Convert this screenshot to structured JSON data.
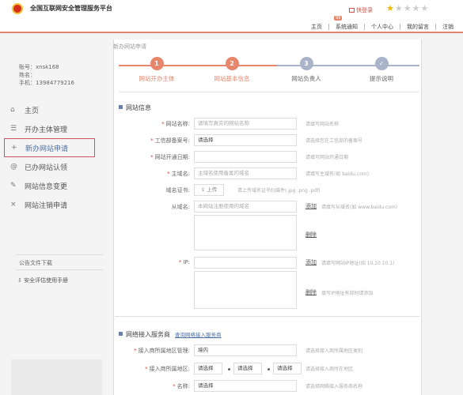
{
  "header": {
    "site_title": "全国互联网安全管理服务平台",
    "login_label": "快登录",
    "badge": "99",
    "nav": [
      "主页",
      "系统通知",
      "个人中心",
      "我的留言",
      "注销"
    ]
  },
  "colors": {
    "accent": "#e8866c",
    "active_border": "#d0505c",
    "link": "#4a6fa5",
    "step_pending": "#a9b3c9"
  },
  "rating": {
    "value": 1,
    "max": 5
  },
  "user": {
    "account": "账号：xnsk168",
    "name": "姓名：",
    "phone": "手机：13984779216"
  },
  "menu": [
    {
      "icon": "home-icon",
      "glyph": "⌂",
      "label": "主页"
    },
    {
      "icon": "list-icon",
      "glyph": "☰",
      "label": "开办主体管理"
    },
    {
      "icon": "plus-icon",
      "glyph": "+",
      "label": "新办网站申请"
    },
    {
      "icon": "at-icon",
      "glyph": "@",
      "label": "已办网站认领"
    },
    {
      "icon": "edit-icon",
      "glyph": "✎",
      "label": "网站信息变更"
    },
    {
      "icon": "cross-icon",
      "glyph": "×",
      "label": "网站注销申请"
    }
  ],
  "downloads": {
    "title": "公告文件下载",
    "manual": "安全评估使用手册"
  },
  "breadcrumb": "新办网站申请",
  "steps": [
    {
      "num": "1",
      "label": "网站开办主体",
      "state": "done"
    },
    {
      "num": "2",
      "label": "网站基本信息",
      "state": "current"
    },
    {
      "num": "3",
      "label": "网站负责人",
      "state": "pending"
    },
    {
      "num": "✓",
      "label": "提示说明",
      "state": "pending"
    }
  ],
  "website_info": {
    "title": "网站信息",
    "name_label": "网站名称:",
    "name_placeholder": "请填写真实的网站名称",
    "name_hint": "请填写网站名称",
    "icp_label": "工信部备案号:",
    "icp_value": "请选择",
    "icp_hint": "请选择您在工信部的备案号",
    "open_date_label": "网站开通日期:",
    "open_date_hint": "请填写网站开通日期",
    "domain_label": "主域名:",
    "domain_placeholder": "主域名使用备案的域名",
    "domain_hint": "请填写主域名(如 baidu.com)",
    "cert_label": "域名证书:",
    "cert_button": "上传",
    "cert_hint": "请上传域名证书扫描件(.jpg .png .pdf)",
    "subdomain_label": "从域名:",
    "subdomain_placeholder": "本网站注册使用的域名",
    "add_label": "添加",
    "subdomain_hint": "请填写从域名(如 www.baidu.com)",
    "delete_label": "删除",
    "ip_label": "IP:",
    "ip_hint": "请填写网站IP地址(如 10.10.10.1)",
    "ip_delete_hint": "填写IP地址有效时请添加"
  },
  "network_access": {
    "title": "网络接入服务商",
    "link": "查询网络接入服务商",
    "region_label": "接入商所属地区管理:",
    "region_value": "境内",
    "region_hint": "请选择接入商所属地区类别",
    "area_label": "接入商所属地区:",
    "area_values": [
      "请选择",
      "请选择",
      "请选择"
    ],
    "area_hint": "请选择接入商所在地区",
    "name_label": "名称:",
    "name_value": "请选择",
    "name_hint": "请选择网络接入服务商名称"
  }
}
